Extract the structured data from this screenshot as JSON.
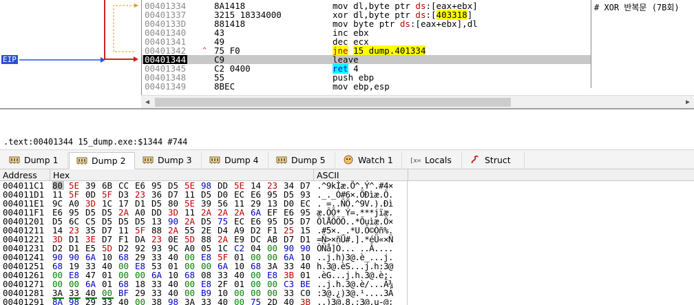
{
  "eip_label": "EIP",
  "disasm": {
    "comment": "# XOR 반복문 (7B회)",
    "rows": [
      {
        "addr": "00401334",
        "mark": "",
        "bytes": "8A1418",
        "asm": [
          {
            "t": "mov dl,byte ptr "
          },
          {
            "t": "ds",
            "c": "red"
          },
          {
            "t": ":[eax+ebx]"
          }
        ]
      },
      {
        "addr": "00401337",
        "mark": "",
        "bytes": "3215 18334000",
        "asm": [
          {
            "t": "xor dl,byte ptr "
          },
          {
            "t": "ds",
            "c": "red"
          },
          {
            "t": ":["
          },
          {
            "t": "403318",
            "c": "yellow"
          },
          {
            "t": "]"
          }
        ]
      },
      {
        "addr": "0040133D",
        "mark": "",
        "bytes": "881418",
        "asm": [
          {
            "t": "mov byte ptr "
          },
          {
            "t": "ds",
            "c": "red"
          },
          {
            "t": ":[eax+ebx],dl"
          }
        ]
      },
      {
        "addr": "00401340",
        "mark": "",
        "bytes": "43",
        "asm": [
          {
            "t": "inc ebx"
          }
        ]
      },
      {
        "addr": "00401341",
        "mark": "",
        "bytes": "49",
        "asm": [
          {
            "t": "dec ecx"
          }
        ]
      },
      {
        "addr": "00401342",
        "mark": "^",
        "bytes": "75 F0",
        "asm": [
          {
            "t": "jne",
            "c": "yellowred"
          },
          {
            "t": " "
          },
          {
            "t": "15_dump.401334",
            "c": "yellow"
          }
        ]
      },
      {
        "addr": "00401344",
        "mark": "",
        "bytes": "C9",
        "asm": [
          {
            "t": "leave"
          }
        ],
        "current": true
      },
      {
        "addr": "00401345",
        "mark": "",
        "bytes": "C2 0400",
        "asm": [
          {
            "t": "ret",
            "c": "bluehl"
          },
          {
            "t": " 4"
          }
        ]
      },
      {
        "addr": "00401348",
        "mark": "",
        "bytes": "55",
        "asm": [
          {
            "t": "push ebp"
          }
        ]
      },
      {
        "addr": "00401349",
        "mark": "",
        "bytes": "8BEC",
        "asm": [
          {
            "t": "mov ebp,esp"
          }
        ]
      }
    ]
  },
  "info_line": ".text:00401344 15_dump.exe:$1344 #744",
  "tabs": [
    {
      "label": "Dump 1",
      "icon": "memory-icon",
      "active": false
    },
    {
      "label": "Dump 2",
      "icon": "memory-icon",
      "active": true
    },
    {
      "label": "Dump 3",
      "icon": "memory-icon",
      "active": false
    },
    {
      "label": "Dump 4",
      "icon": "memory-icon",
      "active": false
    },
    {
      "label": "Dump 5",
      "icon": "memory-icon",
      "active": false
    },
    {
      "label": "Watch 1",
      "icon": "watch-icon",
      "active": false
    },
    {
      "label": "Locals",
      "icon": "variable-icon",
      "active": false
    },
    {
      "label": "Struct",
      "icon": "struct-icon",
      "active": false
    }
  ],
  "dump": {
    "headers": {
      "address": "Address",
      "hex": "Hex",
      "ascii": "ASCII"
    },
    "rows": [
      {
        "addr": "004011C1",
        "hex": [
          "80",
          "5E",
          "39",
          "6B",
          "CC",
          "E6",
          "95",
          "D5",
          "5E",
          "98",
          "DD",
          "5E",
          "14",
          "23",
          "34",
          "D7"
        ],
        "ascii": ".^9kÌæ.Õ^.Ý^.#4×"
      },
      {
        "addr": "004011D1",
        "hex": [
          "11",
          "5F",
          "0D",
          "5F",
          "D3",
          "23",
          "36",
          "D7",
          "11",
          "D5",
          "D0",
          "EC",
          "E6",
          "95",
          "D5",
          "93"
        ],
        "ascii": "._._Ó#6×.ÕÐìæ.Õ."
      },
      {
        "addr": "004011E1",
        "hex": [
          "9C",
          "A0",
          "3D",
          "1C",
          "17",
          "D1",
          "D5",
          "80",
          "5E",
          "39",
          "56",
          "11",
          "29",
          "13",
          "D0",
          "EC"
        ],
        "ascii": ". =..ÑÕ.^9V.).Ðì"
      },
      {
        "addr": "004011F1",
        "hex": [
          "E6",
          "95",
          "D5",
          "D5",
          "2A",
          "A0",
          "DD",
          "3D",
          "11",
          "2A",
          "2A",
          "2A",
          "6A",
          "EF",
          "E6",
          "95"
        ],
        "ascii": "æ.ÕÕ* Ý=.***jïæ."
      },
      {
        "addr": "00401201",
        "hex": [
          "D5",
          "6C",
          "C5",
          "D5",
          "D5",
          "D5",
          "13",
          "90",
          "2A",
          "D5",
          "75",
          "EC",
          "E6",
          "95",
          "D5",
          "D7"
        ],
        "ascii": "ÕlÅÕÕÕ..*Õuìæ.Õ×"
      },
      {
        "addr": "00401211",
        "hex": [
          "14",
          "23",
          "35",
          "D7",
          "11",
          "5F",
          "88",
          "2A",
          "55",
          "2E",
          "D4",
          "A9",
          "D2",
          "F1",
          "25",
          "15"
        ],
        "ascii": ".#5×._.*U.Ô©Òñ%."
      },
      {
        "addr": "00401221",
        "hex": [
          "3D",
          "D1",
          "3E",
          "D7",
          "F1",
          "DA",
          "23",
          "0E",
          "5D",
          "88",
          "2A",
          "E9",
          "DC",
          "AB",
          "D7",
          "D1"
        ],
        "ascii": "=Ñ>×ñÚ#.].*éÜ«×Ñ"
      },
      {
        "addr": "00401231",
        "hex": [
          "D2",
          "D1",
          "E5",
          "5D",
          "D2",
          "92",
          "93",
          "9C",
          "A0",
          "05",
          "1C",
          "C2",
          "04",
          "00",
          "90",
          "90"
        ],
        "ascii": "ÒÑå]Ò... ..Â...."
      },
      {
        "addr": "00401241",
        "hex": [
          "90",
          "90",
          "6A",
          "10",
          "68",
          "29",
          "33",
          "40",
          "00",
          "E8",
          "5F",
          "01",
          "00",
          "00",
          "6A",
          "10"
        ],
        "ascii": "..j.h)3@.è_...j."
      },
      {
        "addr": "00401251",
        "hex": [
          "68",
          "19",
          "33",
          "40",
          "00",
          "E8",
          "53",
          "01",
          "00",
          "00",
          "6A",
          "10",
          "68",
          "3A",
          "33",
          "40"
        ],
        "ascii": "h.3@.èS...j.h:3@"
      },
      {
        "addr": "00401261",
        "hex": [
          "00",
          "E8",
          "47",
          "01",
          "00",
          "00",
          "6A",
          "10",
          "68",
          "08",
          "33",
          "40",
          "00",
          "E8",
          "3B",
          "01"
        ],
        "ascii": ".èG...j.h.3@.è;."
      },
      {
        "addr": "00401271",
        "hex": [
          "00",
          "00",
          "6A",
          "01",
          "68",
          "18",
          "33",
          "40",
          "00",
          "E8",
          "2F",
          "01",
          "00",
          "00",
          "C3",
          "BE"
        ],
        "ascii": "..j.h.3@.è/...Ã¾"
      },
      {
        "addr": "00401281",
        "hex": [
          "3A",
          "33",
          "40",
          "00",
          "BF",
          "29",
          "33",
          "40",
          "00",
          "B9",
          "10",
          "00",
          "00",
          "00",
          "33",
          "C0"
        ],
        "ascii": ":3@.¿)3@.¹....3À"
      },
      {
        "addr": "00401291",
        "hex": [
          "8A",
          "98",
          "29",
          "33",
          "40",
          "00",
          "38",
          "98",
          "3A",
          "33",
          "40",
          "00",
          "75",
          "2D",
          "40",
          "3B"
        ],
        "ascii": "..)3@.8.:3@.u-@;"
      }
    ]
  },
  "colors": {
    "eip_blue": "#2a50d0",
    "jump_red": "#d02020",
    "jump_gold": "#d4a017",
    "highlight_yellow": "#ffff00"
  }
}
